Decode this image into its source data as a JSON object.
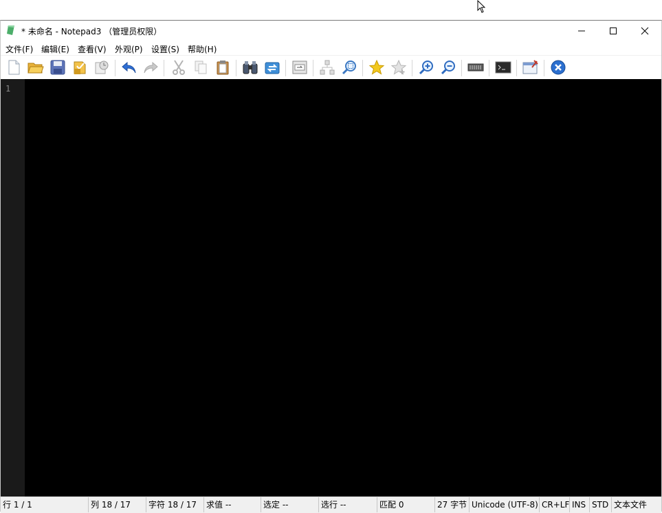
{
  "window": {
    "title": "* 未命名 - Notepad3 （管理员权限）"
  },
  "menu": [
    {
      "label": "文件(F)"
    },
    {
      "label": "编辑(E)"
    },
    {
      "label": "查看(V)"
    },
    {
      "label": "外观(P)"
    },
    {
      "label": "设置(S)"
    },
    {
      "label": "帮助(H)"
    }
  ],
  "toolbar_icons": [
    "new-file-icon",
    "open-folder-icon",
    "save-icon",
    "save-as-icon",
    "save-copy-icon",
    "undo-icon",
    "redo-icon",
    "cut-icon",
    "copy-icon",
    "paste-icon",
    "find-binoculars-icon",
    "replace-icon",
    "goto-line-icon",
    "sitemap-icon",
    "zoom-find-icon",
    "favorite-star-icon",
    "add-favorite-icon",
    "zoom-in-icon",
    "zoom-out-icon",
    "encoding-icon",
    "terminal-icon",
    "pin-window-icon",
    "exit-icon"
  ],
  "editor": {
    "line_numbers": [
      "1"
    ],
    "background": "#000000",
    "gutter": "#1a1a1a"
  },
  "status": {
    "line": "行  1 / 1",
    "column": "列  18 / 17",
    "char": "字符  18 / 17",
    "eval": "求值  --",
    "selection": "选定  --",
    "sel_lines": "选行  --",
    "match": "匹配  0",
    "bytes": "27 字节",
    "encoding": "Unicode (UTF-8)",
    "eol": "CR+LF",
    "ins": "INS",
    "std": "STD",
    "lexer": "文本文件"
  }
}
